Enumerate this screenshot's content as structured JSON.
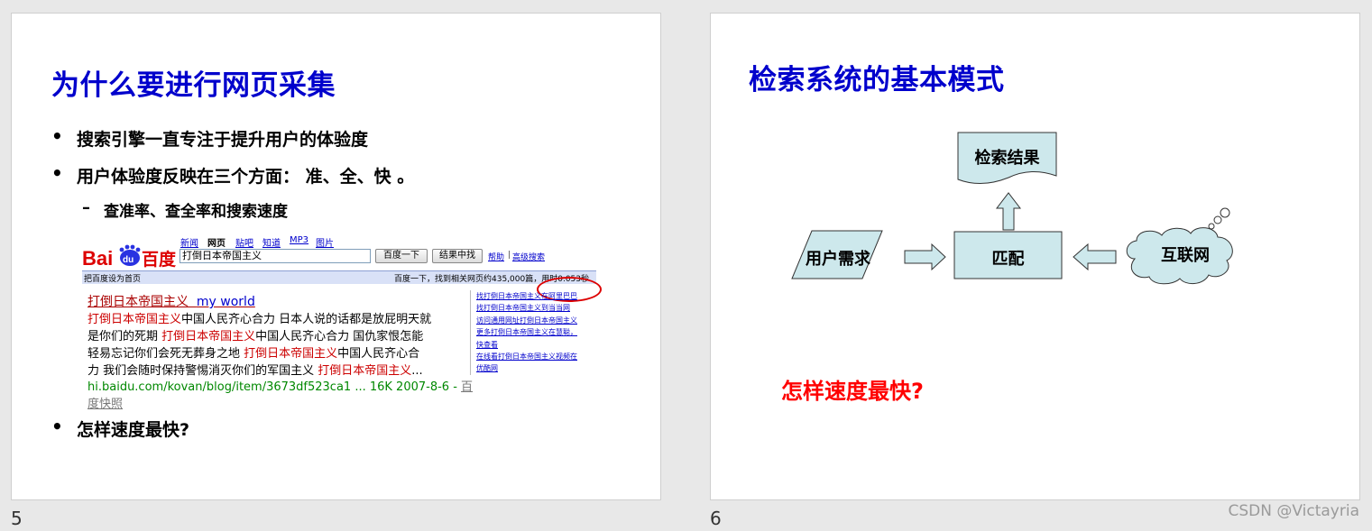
{
  "slides": [
    {
      "number": "5",
      "title": "为什么要进行网页采集",
      "bullets": [
        "搜索引擎一直专注于提升用户的体验度",
        "用户体验度反映在三个方面： 准、全、快 。"
      ],
      "sub_bullet": "查准率、查全率和搜索速度",
      "last_bullet": "怎样速度最快?",
      "baidu": {
        "logo_text": "百度",
        "nav": [
          "新闻",
          "网页",
          "贴吧",
          "知道",
          "MP3",
          "图片"
        ],
        "active_nav": "网页",
        "query": "打倒日本帝国主义",
        "search_button": "百度一下",
        "within_button": "结果中找",
        "help_link": "帮助",
        "advanced_link": "高级搜索",
        "set_home": "把百度设为首页",
        "stats": "百度一下，找到相关网页约435,000篇，用时0.053秒",
        "result": {
          "title_cn": "打倒日本帝国主义",
          "title_en": "my world",
          "lines": [
            [
              [
                "打倒日本帝国主义",
                true
              ],
              [
                "中国人民齐心合力  日本人说的话都是放屁明天就",
                false
              ]
            ],
            [
              [
                "是你们的死期  ",
                false
              ],
              [
                "打倒日本帝国主义",
                true
              ],
              [
                "中国人民齐心合力  国仇家恨怎能",
                false
              ]
            ],
            [
              [
                "轻易忘记你们会死无葬身之地  ",
                false
              ],
              [
                "打倒日本帝国主义",
                true
              ],
              [
                "中国人民齐心合",
                false
              ]
            ],
            [
              [
                "力  我们会随时保持警惕消灭你们的军国主义  ",
                false
              ],
              [
                "打倒日本帝国主义",
                true
              ],
              [
                "...",
                false
              ]
            ]
          ],
          "url": "hi.baidu.com/kovan/blog/item/3673df523ca1 ... 16K 2007-8-6 - ",
          "cache_a": "百",
          "cache_b": "度快照"
        },
        "side_links": [
          "找打倒日本帝国主义在阿里巴巴",
          "找打倒日本帝国主义到当当网",
          "访问通用网址打倒日本帝国主义",
          "更多打倒日本帝国主义在慧聪，",
          "快查看",
          "在线看打倒日本帝国主义视频在",
          "优酷网"
        ]
      }
    },
    {
      "number": "6",
      "title": "检索系统的基本模式",
      "nodes": {
        "result": "检索结果",
        "demand": "用户需求",
        "match": "匹配",
        "internet": "互联网"
      },
      "question": "怎样速度最快?"
    }
  ],
  "watermark": "CSDN @Victayria",
  "colors": {
    "title": "#0000cc",
    "question": "#ff0000",
    "shape_fill": "#cde8ec"
  }
}
